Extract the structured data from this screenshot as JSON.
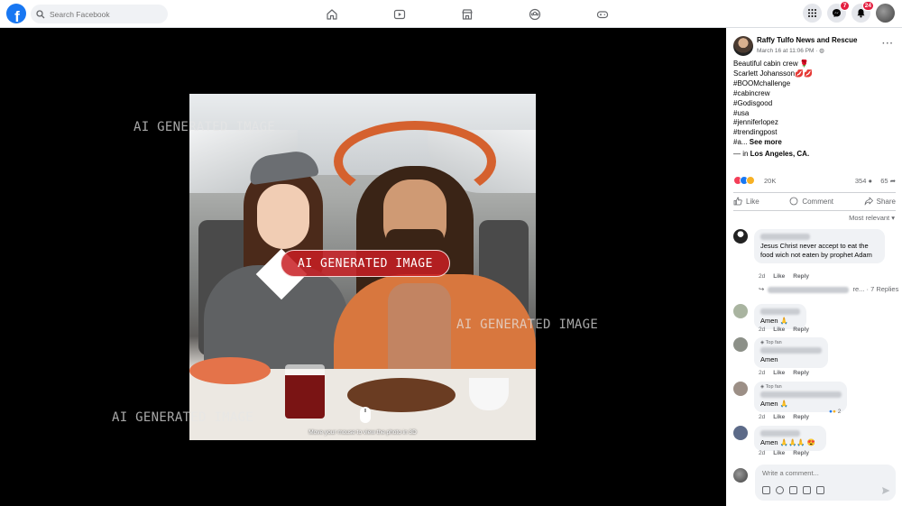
{
  "topbar": {
    "logo_letter": "f",
    "search_placeholder": "Search Facebook",
    "nav": [
      "home-icon",
      "video-icon",
      "marketplace-icon",
      "groups-icon",
      "gaming-icon"
    ],
    "messenger_badge": "7",
    "notifications_badge": "24"
  },
  "viewer": {
    "watermark": "AI GENERATED IMAGE",
    "pill": "AI GENERATED IMAGE",
    "caption": "Move your mouse to view the photo in 3D"
  },
  "post": {
    "page_name": "Raffy Tulfo News and Rescue",
    "date": "March 16 at 11:06 PM · ",
    "lines": [
      "Beautiful cabin crew 🌹",
      "Scarlett Johansson💋💋",
      "#BOOMchallenge",
      "#cabincrew",
      "#Godisgood",
      "#usa",
      "#jenniferlopez",
      "#trendingpost"
    ],
    "last_line": "#a... ",
    "see_more": "See more",
    "location_prefix": "— in ",
    "location": "Los Angeles, CA.",
    "reactions": "20K",
    "comments": "354",
    "shares": "65",
    "like_label": "Like",
    "comment_label": "Comment",
    "share_label": "Share",
    "sort": "Most relevant"
  },
  "comments": [
    {
      "text": "Jesus Christ never accept to eat the food wich not eaten by prophet Adam",
      "time": "2d",
      "like": "Like",
      "reply": "Reply"
    },
    {
      "text": "Amen 🙏",
      "time": "2d",
      "like": "Like",
      "reply": "Reply"
    },
    {
      "badge": "Top fan",
      "text": "Amen",
      "time": "2d",
      "like": "Like",
      "reply": "Reply"
    },
    {
      "badge": "Top fan",
      "text": "Amen 🙏",
      "time": "2d",
      "like": "Like",
      "reply": "Reply",
      "reaction_count": "2"
    },
    {
      "text": "Amen 🙏🙏🙏 😍",
      "time": "2d",
      "like": "Like",
      "reply": "Reply"
    }
  ],
  "replies": {
    "truncated": "re...",
    "count": "· 7 Replies"
  },
  "compose": {
    "placeholder": "Write a comment..."
  }
}
